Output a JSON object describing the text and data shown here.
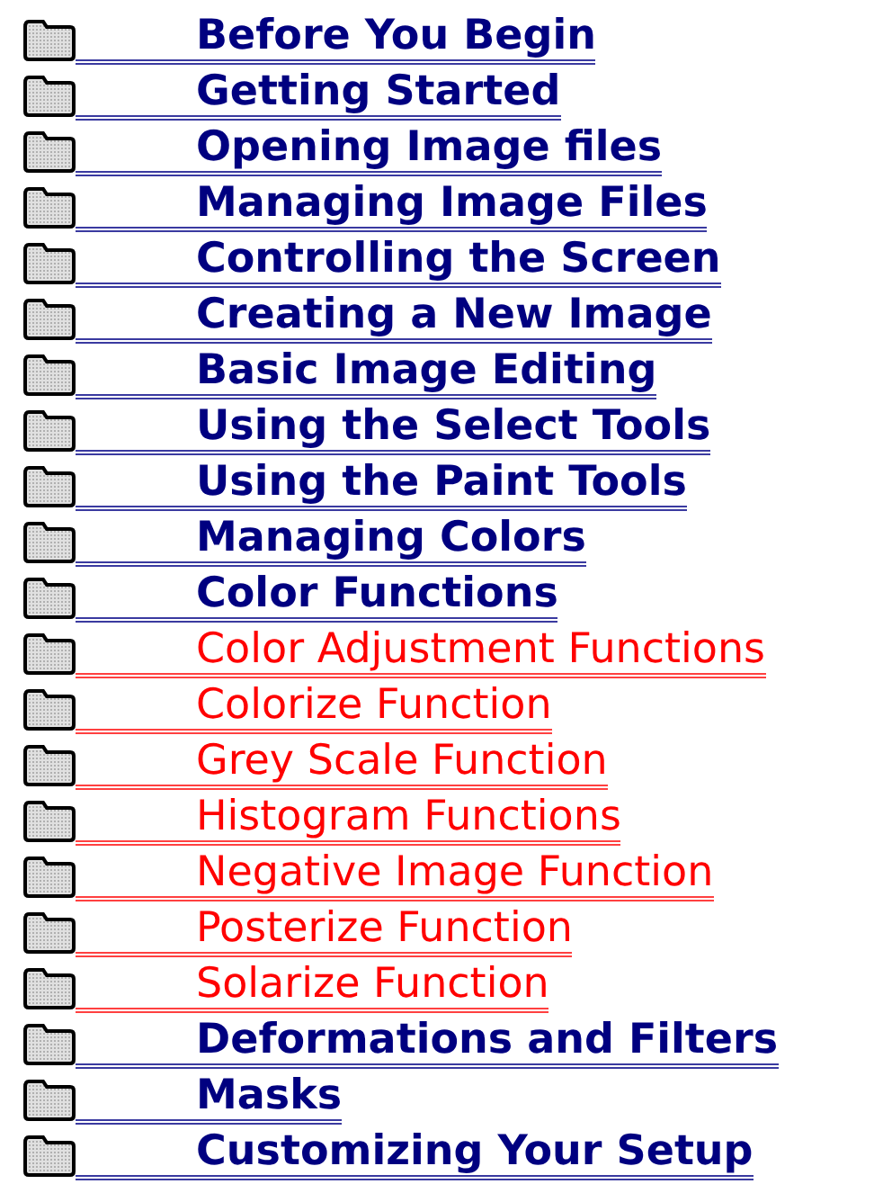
{
  "topics": [
    {
      "label": "Before You Begin"
    },
    {
      "label": "Getting Started"
    },
    {
      "label": "Opening Image files"
    },
    {
      "label": "Managing Image Files"
    },
    {
      "label": "Controlling the Screen"
    },
    {
      "label": "Creating a New Image"
    },
    {
      "label": "Basic Image Editing"
    },
    {
      "label": "Using the Select Tools"
    },
    {
      "label": "Using the Paint Tools"
    },
    {
      "label": "Managing Colors"
    },
    {
      "label": "Color Functions",
      "children": [
        {
          "label": "Color Adjustment Functions"
        },
        {
          "label": "Colorize Function"
        },
        {
          "label": "Grey Scale Function"
        },
        {
          "label": "Histogram Functions"
        },
        {
          "label": "Negative Image Function"
        },
        {
          "label": "Posterize Function"
        },
        {
          "label": "Solarize Function"
        }
      ]
    },
    {
      "label": "Deformations and Filters"
    },
    {
      "label": "Masks"
    },
    {
      "label": "Customizing Your Setup"
    }
  ]
}
